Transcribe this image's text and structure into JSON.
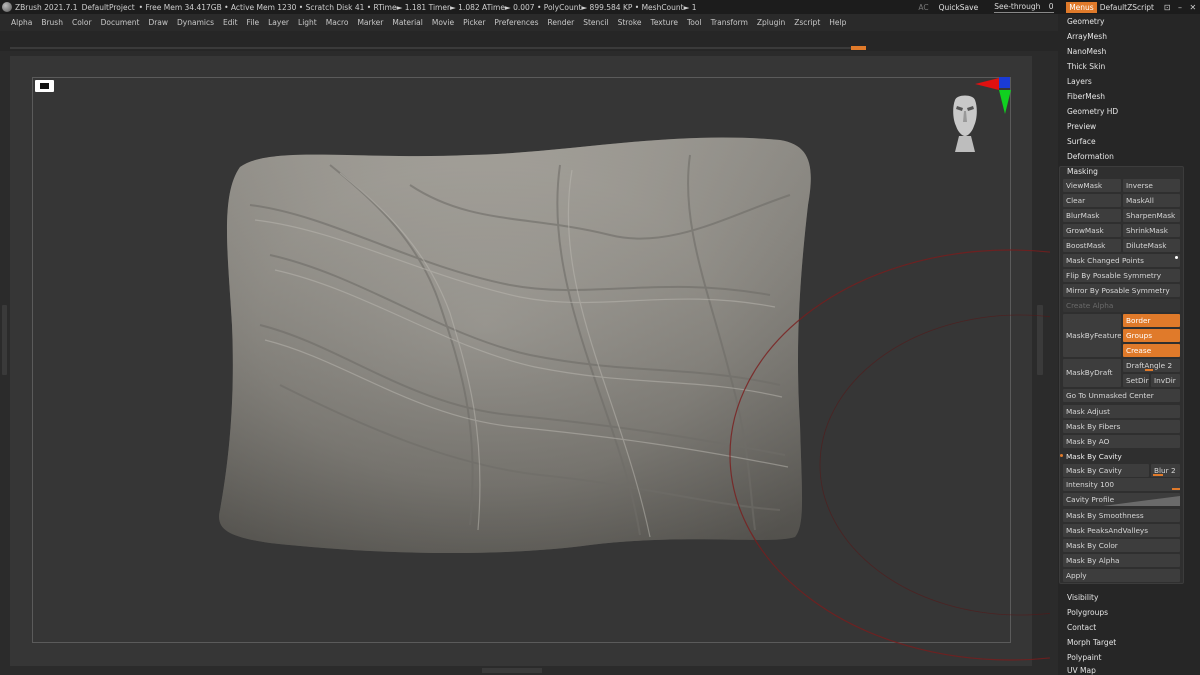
{
  "titlebar": {
    "app": "ZBrush 2021.7.1",
    "project": "DefaultProject",
    "stats": "• Free Mem 34.417GB • Active Mem 1230 • Scratch Disk 41 •  RTime► 1.181 Timer► 1.082 ATime► 0.007 • PolyCount► 899.584 KP • MeshCount► 1",
    "ac": "AC",
    "quicksave": "QuickSave",
    "seethrough_label": "See-through",
    "seethrough_value": "0",
    "menus": "Menus",
    "script": "DefaultZScript",
    "win_controls": [
      "⊡",
      "–",
      "✕"
    ]
  },
  "menubar": [
    "Alpha",
    "Brush",
    "Color",
    "Document",
    "Draw",
    "Dynamics",
    "Edit",
    "File",
    "Layer",
    "Light",
    "Macro",
    "Marker",
    "Material",
    "Movie",
    "Picker",
    "Preferences",
    "Render",
    "Stencil",
    "Stroke",
    "Texture",
    "Tool",
    "Transform",
    "Zplugin",
    "Zscript",
    "Help"
  ],
  "panel": {
    "top_items": [
      "Geometry",
      "ArrayMesh",
      "NanoMesh",
      "Thick Skin",
      "Layers",
      "FiberMesh",
      "Geometry HD",
      "Preview",
      "Surface",
      "Deformation"
    ],
    "masking": {
      "title": "Masking",
      "viewmask": "ViewMask",
      "inverse": "Inverse",
      "clear": "Clear",
      "maskall": "MaskAll",
      "blurmask": "BlurMask",
      "sharpenmask": "SharpenMask",
      "growmask": "GrowMask",
      "shrinkmask": "ShrinkMask",
      "boostmask": "BoostMask",
      "dilutemask": "DiluteMask",
      "mask_changed_points": "Mask Changed Points",
      "flip_by_posable": "Flip By Posable Symmetry",
      "mirror_by_posable": "Mirror By Posable Symmetry",
      "create_alpha": "Create Alpha",
      "mask_by_feature": "MaskByFeature",
      "border": "Border",
      "groups": "Groups",
      "crease": "Crease",
      "mask_by_draft": "MaskByDraft",
      "draft_angle": "DraftAngle 2",
      "setdir": "SetDir",
      "invdir": "InvDir",
      "go_to_unmasked": "Go To Unmasked Center",
      "mask_adjust": "Mask Adjust",
      "mask_by_fibers": "Mask By Fibers",
      "mask_by_ao": "Mask By AO",
      "mask_by_cavity_header": "Mask By Cavity",
      "mask_by_cavity_btn": "Mask By Cavity",
      "blur": "Blur 2",
      "intensity": "Intensity 100",
      "cavity_profile": "Cavity Profile",
      "mask_by_smoothness": "Mask By Smoothness",
      "mask_peaks_valleys": "Mask PeaksAndValleys",
      "mask_by_color": "Mask By Color",
      "mask_by_alpha": "Mask By Alpha",
      "apply": "Apply"
    },
    "bottom_items": [
      "Visibility",
      "Polygroups",
      "Contact",
      "Morph Target",
      "Polypaint",
      "UV Map"
    ]
  },
  "colors": {
    "accent": "#e07a2a",
    "background": "#2b2b2b",
    "canvas": "#363636",
    "panel": "#262626"
  },
  "icons": [
    "zbrush-logo-icon",
    "view-head-icon",
    "axis-gizmo-icon",
    "brush-cursor-ring"
  ]
}
